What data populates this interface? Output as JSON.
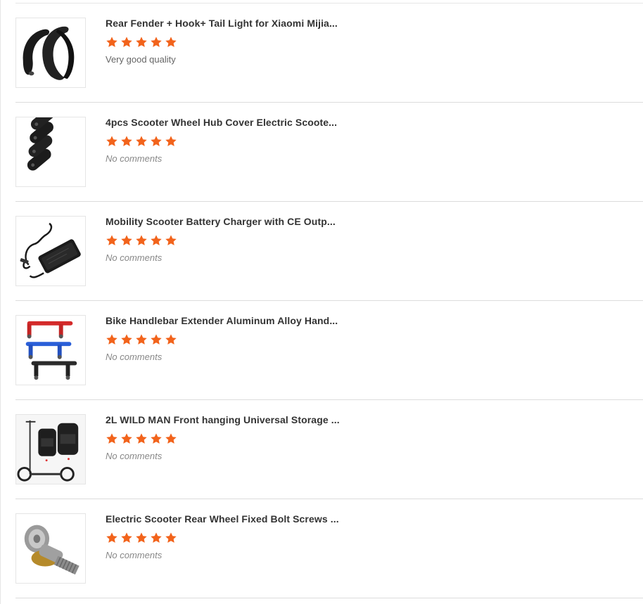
{
  "colors": {
    "star": "#f2631b",
    "divider": "#dcdcdc"
  },
  "reviews": [
    {
      "title": "Rear Fender + Hook+ Tail Light for Xiaomi Mijia...",
      "rating": 5,
      "comment": "Very good quality",
      "image_icon": "fender-image"
    },
    {
      "title": "4pcs Scooter Wheel Hub Cover Electric Scoote...",
      "rating": 5,
      "comment": "No comments",
      "image_icon": "hub-cover-image"
    },
    {
      "title": "Mobility Scooter Battery Charger with CE Outp...",
      "rating": 5,
      "comment": "No comments",
      "image_icon": "charger-image"
    },
    {
      "title": "Bike Handlebar Extender Aluminum Alloy Hand...",
      "rating": 5,
      "comment": "No comments",
      "image_icon": "handlebar-extender-image"
    },
    {
      "title": "2L WILD MAN Front hanging Universal Storage ...",
      "rating": 5,
      "comment": "No comments",
      "image_icon": "storage-bag-image"
    },
    {
      "title": "Electric Scooter Rear Wheel Fixed Bolt Screws ...",
      "rating": 5,
      "comment": "No comments",
      "image_icon": "bolt-screw-image"
    }
  ]
}
